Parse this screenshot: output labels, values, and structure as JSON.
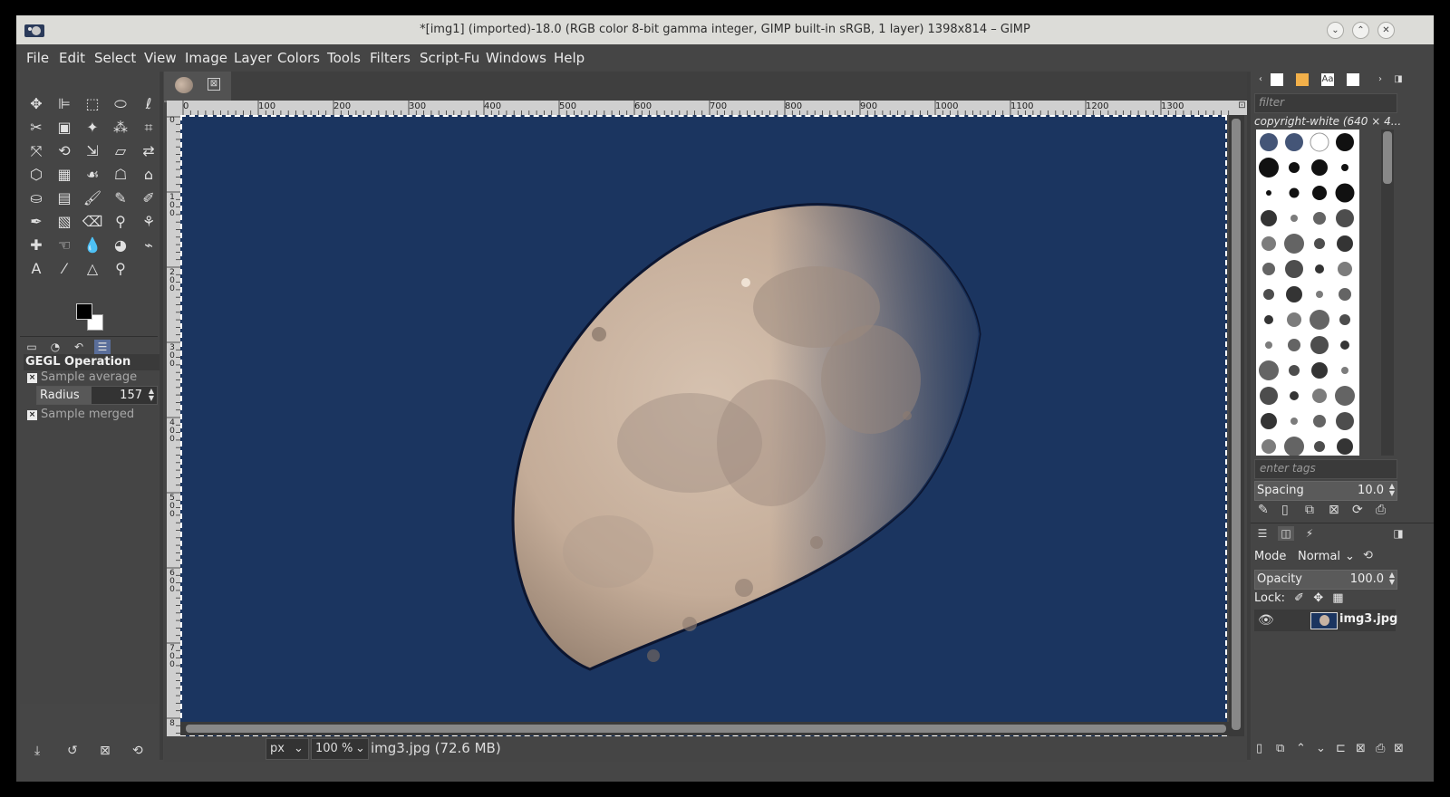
{
  "window": {
    "title": "*[img1] (imported)-18.0 (RGB color 8-bit gamma integer, GIMP built-in sRGB, 1 layer) 1398x814 – GIMP",
    "controls": [
      "⌄",
      "⌃",
      "✕"
    ]
  },
  "menu": [
    "File",
    "Edit",
    "Select",
    "View",
    "Image",
    "Layer",
    "Colors",
    "Tools",
    "Filters",
    "Script-Fu",
    "Windows",
    "Help"
  ],
  "toolbox": {
    "tools": [
      {
        "name": "move-tool-icon",
        "glyph": "✥"
      },
      {
        "name": "align-tool-icon",
        "glyph": "⊫"
      },
      {
        "name": "rect-select-icon",
        "glyph": "⬚"
      },
      {
        "name": "ellipse-select-icon",
        "glyph": "⬭"
      },
      {
        "name": "free-select-icon",
        "glyph": "ℓ"
      },
      {
        "name": "scissors-select-icon",
        "glyph": "✂"
      },
      {
        "name": "foreground-select-icon",
        "glyph": "▣"
      },
      {
        "name": "fuzzy-select-icon",
        "glyph": "✦"
      },
      {
        "name": "by-color-select-icon",
        "glyph": "⁂"
      },
      {
        "name": "crop-tool-icon",
        "glyph": "⌗"
      },
      {
        "name": "unified-transform-icon",
        "glyph": "⤧"
      },
      {
        "name": "rotate-tool-icon",
        "glyph": "⟲"
      },
      {
        "name": "scale-tool-icon",
        "glyph": "⇲"
      },
      {
        "name": "shear-tool-icon",
        "glyph": "▱"
      },
      {
        "name": "flip-tool-icon",
        "glyph": "⇄"
      },
      {
        "name": "perspective-tool-icon",
        "glyph": "⬡"
      },
      {
        "name": "3d-transform-icon",
        "glyph": "▦"
      },
      {
        "name": "warp-transform-icon",
        "glyph": "☙"
      },
      {
        "name": "handle-transform-icon",
        "glyph": "☖"
      },
      {
        "name": "cage-transform-icon",
        "glyph": "⌂"
      },
      {
        "name": "bucket-fill-icon",
        "glyph": "⛀"
      },
      {
        "name": "gradient-tool-icon",
        "glyph": "▤"
      },
      {
        "name": "paintbrush-icon",
        "glyph": "🖌"
      },
      {
        "name": "pencil-icon",
        "glyph": "✎"
      },
      {
        "name": "airbrush-icon",
        "glyph": "✐"
      },
      {
        "name": "ink-tool-icon",
        "glyph": "✒"
      },
      {
        "name": "mypaint-brush-icon",
        "glyph": "▧"
      },
      {
        "name": "eraser-icon",
        "glyph": "⌫"
      },
      {
        "name": "clone-tool-icon",
        "glyph": "⚲"
      },
      {
        "name": "perspective-clone-icon",
        "glyph": "⚘"
      },
      {
        "name": "heal-tool-icon",
        "glyph": "✚"
      },
      {
        "name": "smudge-tool-icon",
        "glyph": "☜"
      },
      {
        "name": "blur-tool-icon",
        "glyph": "💧"
      },
      {
        "name": "dodge-burn-icon",
        "glyph": "◕"
      },
      {
        "name": "paths-tool-icon",
        "glyph": "⌁"
      },
      {
        "name": "text-tool-icon",
        "glyph": "A"
      },
      {
        "name": "color-picker-icon",
        "glyph": "⁄"
      },
      {
        "name": "measure-tool-icon",
        "glyph": "△"
      },
      {
        "name": "zoom-tool-icon",
        "glyph": "⚲"
      }
    ],
    "dock_tabs": [
      "▭",
      "◔",
      "↶",
      "☰"
    ],
    "options_title": "GEGL Operation",
    "sample_average": "Sample average",
    "radius_label": "Radius",
    "radius_value": "157",
    "sample_merged": "Sample merged",
    "check": "×",
    "bottom_icons": [
      "⤓",
      "↺",
      "⊠",
      "⟲"
    ]
  },
  "image_tab": {
    "close": "⊠"
  },
  "ruler": {
    "top": [
      "0",
      "100",
      "200",
      "300",
      "400",
      "500",
      "600",
      "700",
      "800",
      "900",
      "1000",
      "1100",
      "1200",
      "1300"
    ],
    "left": [
      "0",
      "1 0 0",
      "2 0 0",
      "3 0 0",
      "4 0 0",
      "5 0 0",
      "6 0 0",
      "7 0 0",
      "8"
    ]
  },
  "statusbar": {
    "unit": "px",
    "zoom": "100 %",
    "text": "img3.jpg (72.6 MB)",
    "arrow": "⌄"
  },
  "brushes": {
    "filter_placeholder": "filter",
    "selected_name": "copyright-white (640 × 4...",
    "tags_placeholder": "enter tags",
    "spacing_label": "Spacing",
    "spacing_value": "10.0",
    "actions": [
      "✎",
      "▯",
      "⧉",
      "⊠",
      "⟳",
      "⎙"
    ]
  },
  "layers": {
    "mode_label": "Mode",
    "mode_value": "Normal",
    "opacity_label": "Opacity",
    "opacity_value": "100.0",
    "lock_label": "Lock:",
    "lock_icons": [
      "✐",
      "✥",
      "▦"
    ],
    "layer_name": "img3.jpg",
    "tabs": [
      "☰",
      "◫",
      "⚡"
    ],
    "bottom_icons": [
      "▯",
      "⧉",
      "⌃",
      "⌄",
      "⊏",
      "⊠",
      "⎙",
      "⊠"
    ]
  },
  "colors": {
    "canvas_bg": "#1b3560",
    "moon": "#c9b3a0"
  }
}
